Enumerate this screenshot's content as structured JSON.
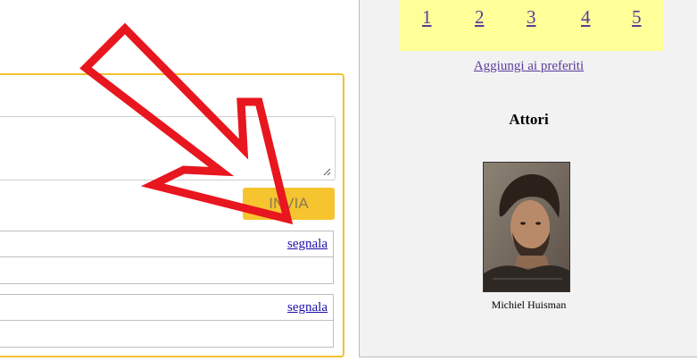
{
  "comment_form": {
    "send_label": "INVIA"
  },
  "comments": [
    {
      "report_label": "segnala"
    },
    {
      "report_label": "segnala"
    }
  ],
  "sidebar": {
    "pages": [
      "1",
      "2",
      "3",
      "4",
      "5"
    ],
    "favorites_label": "Aggiungi ai preferiti",
    "actors_heading": "Attori",
    "actors": [
      {
        "name": "Michiel Huisman"
      }
    ]
  },
  "colors": {
    "accent": "#f6c42f",
    "arrow": "#e8161e",
    "pager_bg": "#ffff99",
    "link": "#5b3a9a"
  }
}
